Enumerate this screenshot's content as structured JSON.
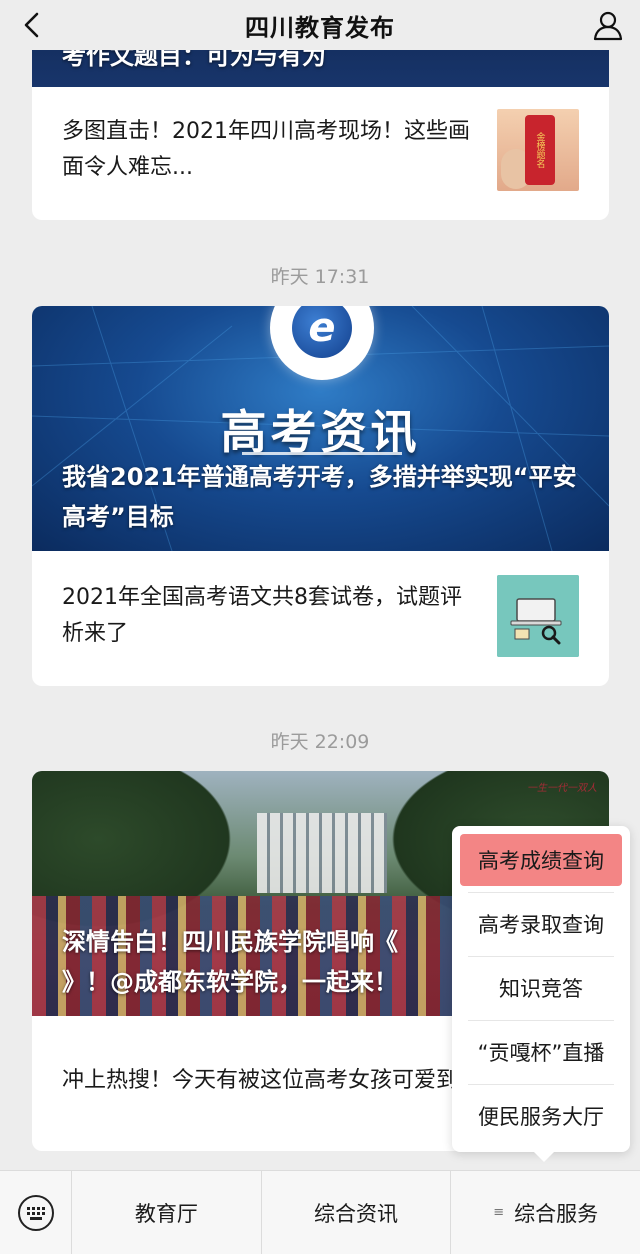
{
  "header": {
    "title": "四川教育发布",
    "back_icon": "chevron-left-icon",
    "user_icon": "person-icon"
  },
  "feed": {
    "cards": [
      {
        "cover_title": "考作文题目：可为与有为",
        "items": [
          {
            "text": "多图直击！2021年四川高考现场！这些画面令人难忘...",
            "thumb_label": "金榜题名"
          }
        ]
      },
      {
        "time": "昨天 17:31",
        "banner": "高考资讯",
        "logo_letter": "e",
        "cover_title": "我省2021年普通高考开考，多措并举实现“平安高考”目标",
        "items": [
          {
            "text": "2021年全国高考语文共8套试卷，试题评析来了"
          }
        ]
      },
      {
        "time": "昨天 22:09",
        "cover_title": "深情告白！四川民族学院唱响《",
        "cover_title_line2": "》！@成都东软学院，一起来！",
        "watermark": "一生一代一双人",
        "items": [
          {
            "text": "冲上热搜！今天有被这位高考女孩可爱到"
          }
        ]
      }
    ]
  },
  "popup_menu": {
    "items": [
      "高考成绩查询",
      "高考录取查询",
      "知识竞答",
      "“贡嘎杯”直播",
      "便民服务大厅"
    ],
    "highlight_color": "#f38585"
  },
  "bottom_bar": {
    "keyboard_icon": "keyboard-icon",
    "tabs": [
      "教育厅",
      "综合资讯",
      "综合服务"
    ],
    "menu_mark": "≡"
  }
}
